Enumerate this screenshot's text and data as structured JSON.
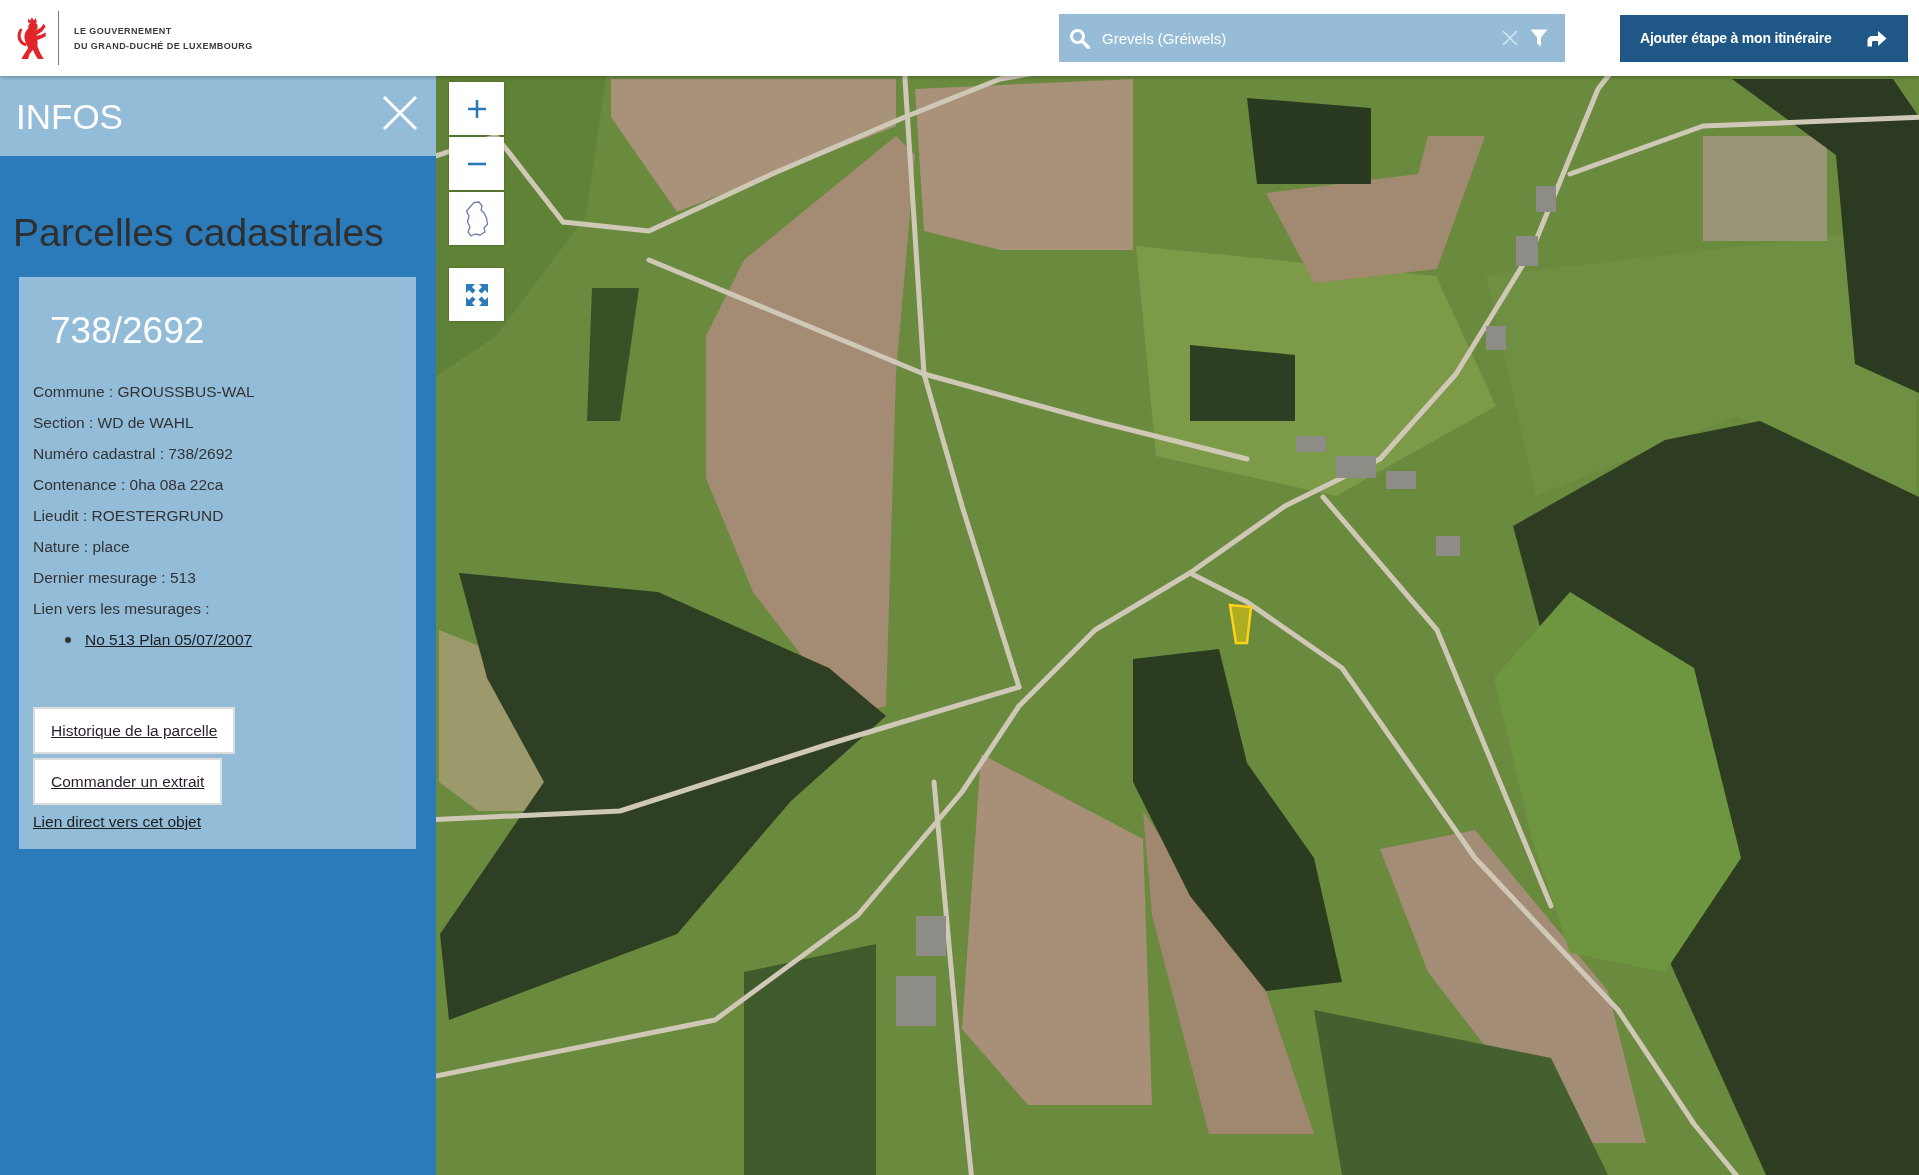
{
  "header": {
    "logo_lines": [
      "LE GOUVERNEMENT",
      "DU GRAND-DUCHÉ DE LUXEMBOURG"
    ],
    "search": {
      "value": "Grevels (Gréiwels)"
    },
    "route_button": "Ajouter étape à mon itinéraire"
  },
  "info_panel": {
    "title": "INFOS",
    "heading": "Parcelles cadastrales",
    "parcel": {
      "number": "738/2692",
      "details": [
        "Commune : GROUSSBUS-WAL",
        "Section : WD de WAHL",
        "Numéro cadastral : 738/2692",
        "Contenance : 0ha 08a 22ca",
        "Lieudit : ROESTERGRUND",
        "Nature : place",
        "Dernier mesurage : 513",
        "Lien vers les mesurages :"
      ],
      "measurement_links": [
        "No 513 Plan 05/07/2007"
      ],
      "buttons": [
        "Historique de la parcelle",
        "Commander un extrait"
      ],
      "direct_link": "Lien direct vers cet objet"
    }
  },
  "map": {
    "controls": [
      {
        "kind": "zoom_in"
      },
      {
        "kind": "zoom_out"
      },
      {
        "kind": "country"
      },
      {
        "kind": "fullscreen"
      }
    ]
  }
}
